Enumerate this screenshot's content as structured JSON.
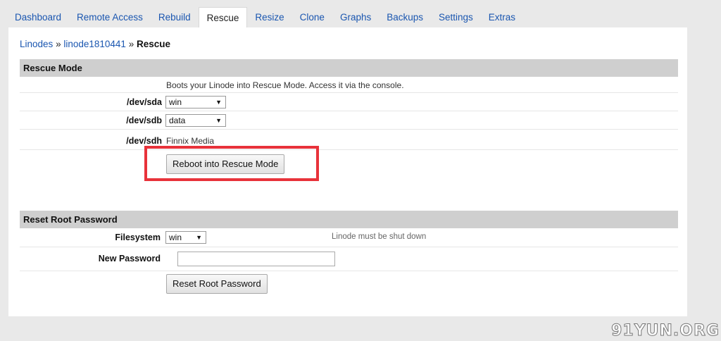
{
  "tabs": [
    {
      "label": "Dashboard",
      "active": false
    },
    {
      "label": "Remote Access",
      "active": false
    },
    {
      "label": "Rebuild",
      "active": false
    },
    {
      "label": "Rescue",
      "active": true
    },
    {
      "label": "Resize",
      "active": false
    },
    {
      "label": "Clone",
      "active": false
    },
    {
      "label": "Graphs",
      "active": false
    },
    {
      "label": "Backups",
      "active": false
    },
    {
      "label": "Settings",
      "active": false
    },
    {
      "label": "Extras",
      "active": false
    }
  ],
  "breadcrumb": {
    "root": "Linodes",
    "separator": "»",
    "linode": "linode1810441",
    "current": "Rescue"
  },
  "rescue": {
    "title": "Rescue Mode",
    "description": "Boots your Linode into Rescue Mode. Access it via the console.",
    "sda_label": "/dev/sda",
    "sda_value": "win",
    "sdb_label": "/dev/sdb",
    "sdb_value": "data",
    "sdh_label": "/dev/sdh",
    "sdh_value": "Finnix Media",
    "reboot_button": "Reboot into Rescue Mode"
  },
  "reset": {
    "title": "Reset Root Password",
    "filesystem_label": "Filesystem",
    "filesystem_value": "win",
    "note": "Linode must be shut down",
    "password_label": "New Password",
    "password_value": "",
    "reset_button": "Reset Root Password"
  },
  "watermark": "91YUN.ORG",
  "colors": {
    "link": "#1a56b0",
    "section_header": "#cfcfcf",
    "highlight_box": "#e8323a",
    "page_background": "#e9e9e9"
  }
}
